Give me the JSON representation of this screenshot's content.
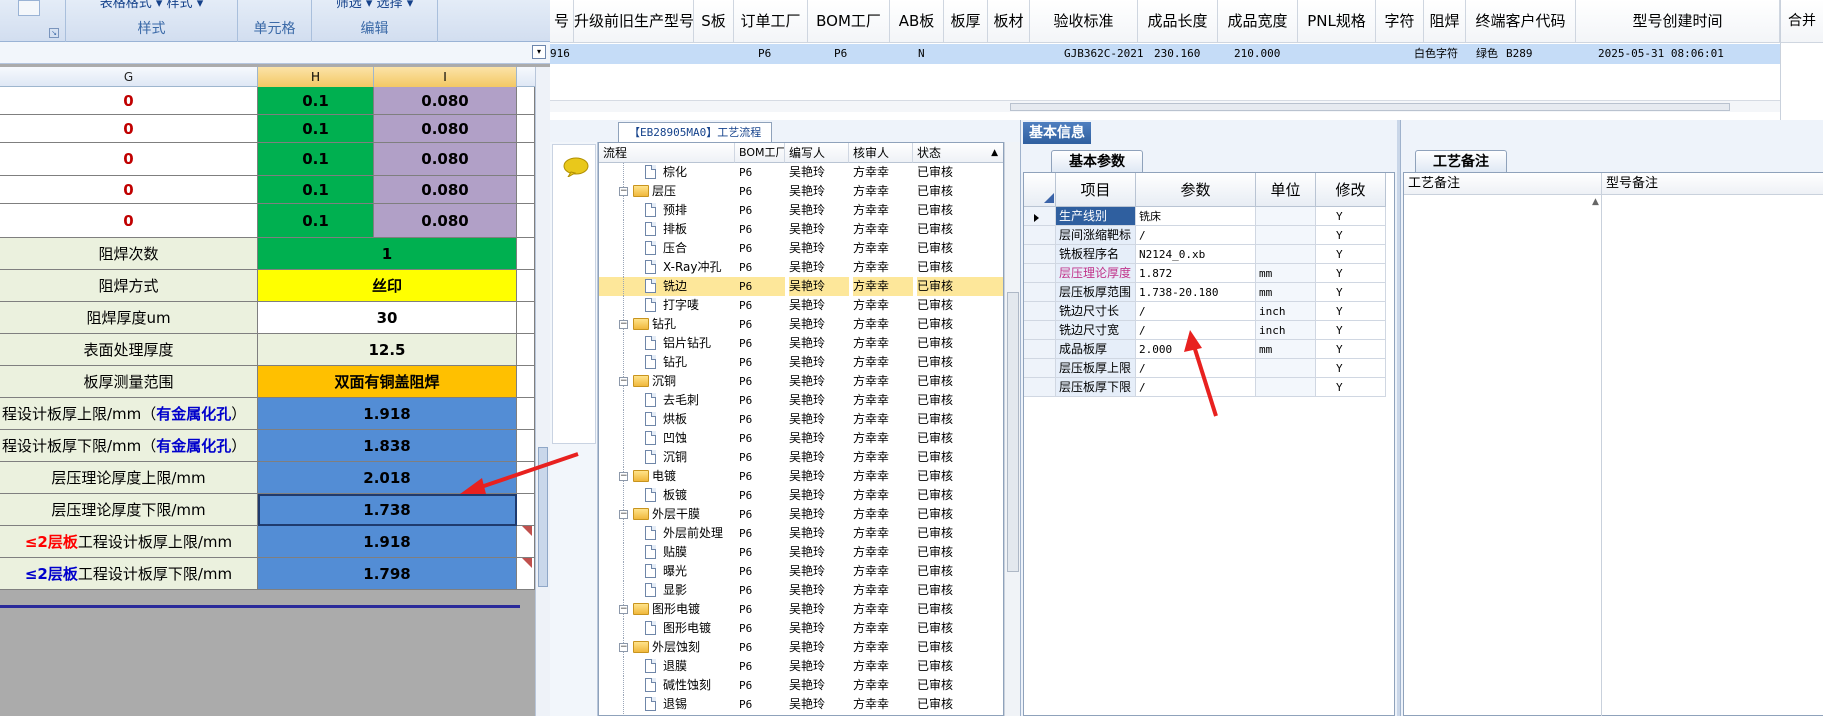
{
  "excel": {
    "ribbon": {
      "groups": [
        {
          "top": "表格格式 ▾ 样式 ▾",
          "label": "样式"
        },
        {
          "top": "",
          "label": "单元格"
        },
        {
          "top": "筛选 ▾ 选择 ▾",
          "label": "编辑"
        }
      ],
      "collapse_glyph": "▾"
    },
    "columns": [
      "G",
      "H",
      "I"
    ],
    "rows": [
      {
        "label": "0",
        "h": "0.1",
        "i": "0.080"
      },
      {
        "label": "0",
        "h": "0.1",
        "i": "0.080"
      },
      {
        "label": "0",
        "h": "0.1",
        "i": "0.080"
      },
      {
        "label": "0",
        "h": "0.1",
        "i": "0.080"
      },
      {
        "label": "0",
        "h": "0.1",
        "i": "0.080"
      }
    ],
    "merged_rows": [
      {
        "label": "阻焊次数",
        "value": "1"
      },
      {
        "label": "阻焊方式",
        "value": "丝印"
      },
      {
        "label": "阻焊厚度um",
        "value": "30"
      },
      {
        "label": "表面处理厚度",
        "value": "12.5"
      },
      {
        "label": "板厚测量范围",
        "value": "双面有铜盖阻焊"
      },
      {
        "label_a": "程设计板厚上限/mm（",
        "label_b": "有金属化孔",
        "label_c": "）",
        "value": "1.918"
      },
      {
        "label_a": "程设计板厚下限/mm（",
        "label_b": "有金属化孔",
        "label_c": "）",
        "value": "1.838"
      },
      {
        "label": "层压理论厚度上限/mm",
        "value": "2.018"
      },
      {
        "label": "层压理论厚度下限/mm",
        "value": "1.738"
      },
      {
        "label_a": "≤2层板",
        "label_b": "工程设计板厚上限/mm",
        "value": "1.918"
      },
      {
        "label_a": "≤2层板",
        "label_b": "工程设计板厚下限/mm",
        "value": "1.798"
      }
    ]
  },
  "order_table": {
    "headers": [
      "号",
      "升级前旧生产型号",
      "S板",
      "订单工厂",
      "BOM工厂",
      "AB板",
      "板厚",
      "板材",
      "验收标准",
      "成品长度",
      "成品宽度",
      "PNL规格",
      "字符",
      "阻焊",
      "终端客户代码",
      "型号创建时间",
      "合并"
    ],
    "row": [
      "916",
      "",
      "",
      "P6",
      "P6",
      "N",
      "",
      "",
      "GJB362C-2021",
      "230.160",
      "210.000",
      "",
      "白色字符",
      "绿色",
      "B289",
      "2025-05-31 08:06:01",
      ""
    ]
  },
  "process": {
    "caption": "【EB28905MA0】工艺流程",
    "headers": [
      "流程",
      "BOM工厂",
      "编写人",
      "核审人",
      "状态"
    ],
    "rows": [
      {
        "name": "棕化",
        "level": 2,
        "type": "doc",
        "bom": "P6",
        "writer": "吴艳玲",
        "reviewer": "方幸幸",
        "status": "已审核"
      },
      {
        "name": "层压",
        "level": 1,
        "type": "folder",
        "bom": "P6",
        "writer": "吴艳玲",
        "reviewer": "方幸幸",
        "status": "已审核"
      },
      {
        "name": "预排",
        "level": 2,
        "type": "doc",
        "bom": "P6",
        "writer": "吴艳玲",
        "reviewer": "方幸幸",
        "status": "已审核"
      },
      {
        "name": "排板",
        "level": 2,
        "type": "doc",
        "bom": "P6",
        "writer": "吴艳玲",
        "reviewer": "方幸幸",
        "status": "已审核"
      },
      {
        "name": "压合",
        "level": 2,
        "type": "doc",
        "bom": "P6",
        "writer": "吴艳玲",
        "reviewer": "方幸幸",
        "status": "已审核"
      },
      {
        "name": "X-Ray冲孔",
        "level": 2,
        "type": "doc",
        "bom": "P6",
        "writer": "吴艳玲",
        "reviewer": "方幸幸",
        "status": "已审核"
      },
      {
        "name": "铣边",
        "level": 2,
        "type": "doc",
        "bom": "P6",
        "writer": "吴艳玲",
        "reviewer": "方幸幸",
        "status": "已审核",
        "selected": true
      },
      {
        "name": "打字唛",
        "level": 2,
        "type": "doc",
        "bom": "P6",
        "writer": "吴艳玲",
        "reviewer": "方幸幸",
        "status": "已审核"
      },
      {
        "name": "钻孔",
        "level": 1,
        "type": "folder",
        "bom": "P6",
        "writer": "吴艳玲",
        "reviewer": "方幸幸",
        "status": "已审核"
      },
      {
        "name": "铝片钻孔",
        "level": 2,
        "type": "doc",
        "bom": "P6",
        "writer": "吴艳玲",
        "reviewer": "方幸幸",
        "status": "已审核"
      },
      {
        "name": "钻孔",
        "level": 2,
        "type": "doc",
        "bom": "P6",
        "writer": "吴艳玲",
        "reviewer": "方幸幸",
        "status": "已审核"
      },
      {
        "name": "沉铜",
        "level": 1,
        "type": "folder",
        "bom": "P6",
        "writer": "吴艳玲",
        "reviewer": "方幸幸",
        "status": "已审核"
      },
      {
        "name": "去毛刺",
        "level": 2,
        "type": "doc",
        "bom": "P6",
        "writer": "吴艳玲",
        "reviewer": "方幸幸",
        "status": "已审核"
      },
      {
        "name": "烘板",
        "level": 2,
        "type": "doc",
        "bom": "P6",
        "writer": "吴艳玲",
        "reviewer": "方幸幸",
        "status": "已审核"
      },
      {
        "name": "凹蚀",
        "level": 2,
        "type": "doc",
        "bom": "P6",
        "writer": "吴艳玲",
        "reviewer": "方幸幸",
        "status": "已审核"
      },
      {
        "name": "沉铜",
        "level": 2,
        "type": "doc",
        "bom": "P6",
        "writer": "吴艳玲",
        "reviewer": "方幸幸",
        "status": "已审核"
      },
      {
        "name": "电镀",
        "level": 1,
        "type": "folder",
        "bom": "P6",
        "writer": "吴艳玲",
        "reviewer": "方幸幸",
        "status": "已审核"
      },
      {
        "name": "板镀",
        "level": 2,
        "type": "doc",
        "bom": "P6",
        "writer": "吴艳玲",
        "reviewer": "方幸幸",
        "status": "已审核"
      },
      {
        "name": "外层干膜",
        "level": 1,
        "type": "folder",
        "bom": "P6",
        "writer": "吴艳玲",
        "reviewer": "方幸幸",
        "status": "已审核"
      },
      {
        "name": "外层前处理",
        "level": 2,
        "type": "doc",
        "bom": "P6",
        "writer": "吴艳玲",
        "reviewer": "方幸幸",
        "status": "已审核"
      },
      {
        "name": "贴膜",
        "level": 2,
        "type": "doc",
        "bom": "P6",
        "writer": "吴艳玲",
        "reviewer": "方幸幸",
        "status": "已审核"
      },
      {
        "name": "曝光",
        "level": 2,
        "type": "doc",
        "bom": "P6",
        "writer": "吴艳玲",
        "reviewer": "方幸幸",
        "status": "已审核"
      },
      {
        "name": "显影",
        "level": 2,
        "type": "doc",
        "bom": "P6",
        "writer": "吴艳玲",
        "reviewer": "方幸幸",
        "status": "已审核"
      },
      {
        "name": "图形电镀",
        "level": 1,
        "type": "folder",
        "bom": "P6",
        "writer": "吴艳玲",
        "reviewer": "方幸幸",
        "status": "已审核"
      },
      {
        "name": "图形电镀",
        "level": 2,
        "type": "doc",
        "bom": "P6",
        "writer": "吴艳玲",
        "reviewer": "方幸幸",
        "status": "已审核"
      },
      {
        "name": "外层蚀刻",
        "level": 1,
        "type": "folder",
        "bom": "P6",
        "writer": "吴艳玲",
        "reviewer": "方幸幸",
        "status": "已审核"
      },
      {
        "name": "退膜",
        "level": 2,
        "type": "doc",
        "bom": "P6",
        "writer": "吴艳玲",
        "reviewer": "方幸幸",
        "status": "已审核"
      },
      {
        "name": "碱性蚀刻",
        "level": 2,
        "type": "doc",
        "bom": "P6",
        "writer": "吴艳玲",
        "reviewer": "方幸幸",
        "status": "已审核"
      },
      {
        "name": "退锡",
        "level": 2,
        "type": "doc",
        "bom": "P6",
        "writer": "吴艳玲",
        "reviewer": "方幸幸",
        "status": "已审核"
      }
    ]
  },
  "info": {
    "title": "基本信息",
    "tab": "基本参数",
    "headers": [
      "项目",
      "参数",
      "单位",
      "修改"
    ],
    "rows": [
      {
        "item": "生产线别",
        "param": "铣床",
        "unit": "",
        "mod": "Y",
        "selected": true
      },
      {
        "item": "层间涨缩靶标",
        "param": "/",
        "unit": "",
        "mod": "Y"
      },
      {
        "item": "铣板程序名",
        "param": "N2124_0.xb",
        "unit": "",
        "mod": "Y"
      },
      {
        "item": "层压理论厚度",
        "param": "1.872",
        "unit": "mm",
        "mod": "Y",
        "highlight": true
      },
      {
        "item": "层压板厚范围",
        "param": "1.738-20.180",
        "unit": "mm",
        "mod": "Y"
      },
      {
        "item": "铣边尺寸长",
        "param": "/",
        "unit": "inch",
        "mod": "Y"
      },
      {
        "item": "铣边尺寸宽",
        "param": "/",
        "unit": "inch",
        "mod": "Y"
      },
      {
        "item": "成品板厚",
        "param": "2.000",
        "unit": "mm",
        "mod": "Y"
      },
      {
        "item": "层压板厚上限",
        "param": "/",
        "unit": "",
        "mod": "Y"
      },
      {
        "item": "层压板厚下限",
        "param": "/",
        "unit": "",
        "mod": "Y"
      }
    ]
  },
  "remarks": {
    "tab": "工艺备注",
    "col1": "工艺备注",
    "col2": "型号备注"
  },
  "colors": {
    "accent": "#2f5f9f",
    "selection": "#c5dcf7",
    "tree_selection": "#fde79a",
    "arrow": "#e8211f",
    "highlight_text": "#c0338a"
  },
  "icons": {
    "chat": "speech-bubble-icon",
    "folder": "folder-icon",
    "doc": "document-icon"
  }
}
